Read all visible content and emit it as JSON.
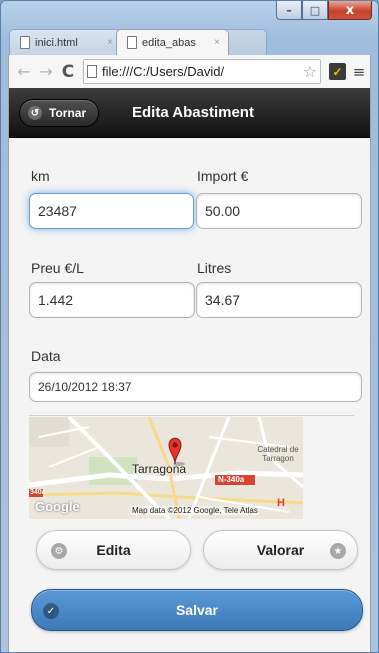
{
  "browser": {
    "tabs": [
      {
        "title": "inici.html",
        "close": "×"
      },
      {
        "title": "edita_abas",
        "close": "×"
      }
    ],
    "address": "file:///C:/Users/David/",
    "nav": {
      "back": "←",
      "forward": "→",
      "reload": "C",
      "star": "☆",
      "menu": "≡",
      "ext": "✓"
    },
    "caption": {
      "minimize": "–",
      "maximize": "□",
      "close": "x"
    }
  },
  "header": {
    "back_label": "Tornar",
    "back_glyph": "↺",
    "title": "Edita Abastiment"
  },
  "form": {
    "km": {
      "label": "km",
      "value": "23487"
    },
    "import": {
      "label": "Import €",
      "value": "50.00"
    },
    "preu": {
      "label": "Preu €/L",
      "value": "1.442"
    },
    "litres": {
      "label": "Litres",
      "value": "34.67"
    },
    "data": {
      "label": "Data",
      "value": "26/10/2012 18:37"
    }
  },
  "map": {
    "city": "Tarragona",
    "road": "N-340a",
    "poi": "Catedral de Tarragon",
    "google": "Google",
    "credit": "Map data ©2012 Google, Tele Atlas",
    "edge": "340a",
    "marker": "H"
  },
  "buttons": {
    "edita": {
      "label": "Edita",
      "glyph": "⚙"
    },
    "valorar": {
      "label": "Valorar",
      "glyph": "★"
    },
    "salvar": {
      "label": "Salvar",
      "glyph": "✓"
    }
  },
  "colors": {
    "header": "#1f1f1f",
    "primary": "#3d79b8",
    "focus": "#6a9fd8"
  }
}
